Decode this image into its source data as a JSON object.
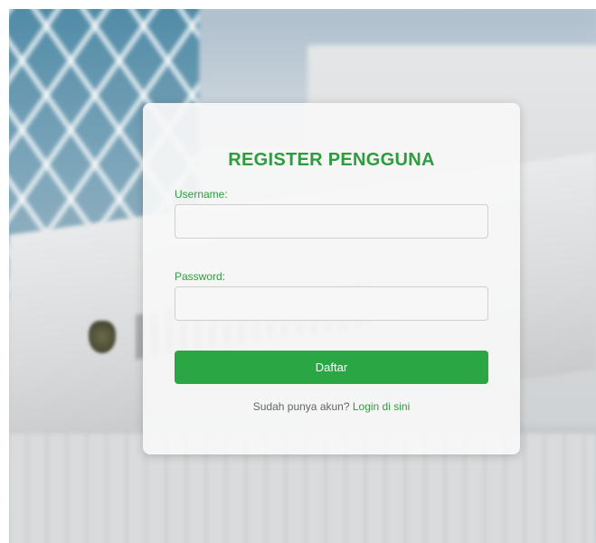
{
  "form": {
    "title": "REGISTER PENGGUNA",
    "username_label": "Username:",
    "username_value": "",
    "password_label": "Password:",
    "password_value": "",
    "submit_label": "Daftar",
    "login_prompt": "Sudah punya akun?",
    "login_link": "Login di sini"
  },
  "colors": {
    "accent": "#2e9c3e",
    "button": "#2ba644",
    "card_background": "#f8f8f8"
  }
}
